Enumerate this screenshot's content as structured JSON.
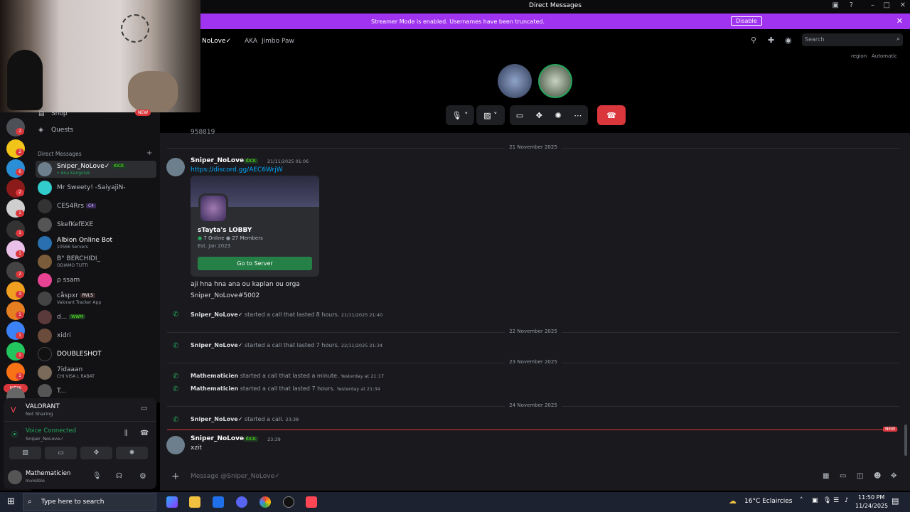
{
  "window": {
    "title": "Direct Messages"
  },
  "streamer": {
    "message": "Streamer Mode is enabled. Usernames have been truncated.",
    "disable_label": "Disable"
  },
  "call_header": {
    "name": "NoLove✓",
    "aka": "AKA",
    "aka_name": "Jimbo Paw",
    "search_placeholder": "Search",
    "region_label": "region",
    "region_value": "Automatic"
  },
  "sidebar": {
    "shop": "Shop",
    "quests": "Quests",
    "dm_header": "Direct Messages",
    "dms": [
      {
        "name": "Sniper_NoLove✓",
        "tag": "KICK",
        "sub": "• Ana Kangolak"
      },
      {
        "name": "Mr Sweety! -SaiyajiN-",
        "tag": "",
        "sub": ""
      },
      {
        "name": "CES4Rrs",
        "tag": "C4",
        "sub": ""
      },
      {
        "name": "SkefKefEXE",
        "tag": "",
        "sub": ""
      },
      {
        "name": "Albion Online Bot",
        "tag": "",
        "sub": "10566 Servers"
      },
      {
        "name": "B° BERCHIDI_",
        "tag": "",
        "sub": "ODIAMO TUTTI"
      },
      {
        "name": "ρ ssam",
        "tag": "",
        "sub": ""
      },
      {
        "name": "cåspxr",
        "tag": "RVLS",
        "sub": "Valorant Tracker App"
      },
      {
        "name": "d...",
        "tag": "WWM",
        "sub": ""
      },
      {
        "name": "xidri",
        "tag": "",
        "sub": ""
      },
      {
        "name": "DOUBLESHOT",
        "tag": "",
        "sub": ""
      },
      {
        "name": "7idaaan",
        "tag": "",
        "sub": "CHI VISA L RABAT"
      },
      {
        "name": "T...",
        "tag": "",
        "sub": ""
      }
    ],
    "new_badge": "NEW",
    "badges": [
      "2",
      "2",
      "6",
      "2",
      "1",
      "1",
      "1",
      "2",
      "3",
      "1",
      "1",
      "1",
      "1"
    ]
  },
  "activity": {
    "game": "VALORANT",
    "status": "Not Sharing"
  },
  "voice": {
    "status": "Voice Connected",
    "channel": "Sniper_NoLove✓"
  },
  "user": {
    "name": "Mathematicien",
    "status": "Invisible"
  },
  "chat": {
    "top_fragment": "958819",
    "dates": [
      "21 November 2025",
      "22 November 2025",
      "23 November 2025",
      "24 November 2025"
    ],
    "msg1": {
      "author": "Sniper_NoLove✓",
      "tag": "KICK",
      "time": "21/11/2025 01:06",
      "link": "https://discord.gg/AEC6WrjW"
    },
    "invite": {
      "server": "sTayta's LOBBY",
      "online": "7 Online",
      "members": "27 Members",
      "est": "Est. Jan 2023",
      "button": "Go to Server"
    },
    "line1": "aji hna hna ana ou kaplan ou orga",
    "line2": "Sniper_NoLove#5002",
    "calls": [
      {
        "author": "Sniper_NoLove✓",
        "text": "started a call that lasted 8 hours.",
        "time": "21/11/2025 21:40"
      },
      {
        "author": "Sniper_NoLove✓",
        "text": "started a call that lasted 7 hours.",
        "time": "22/11/2025 21:34"
      },
      {
        "author": "Mathematicien",
        "text": "started a call that lasted a minute.",
        "time": "Yesterday at 21:17"
      },
      {
        "author": "Mathematicien",
        "text": "started a call that lasted 7 hours.",
        "time": "Yesterday at 21:34"
      },
      {
        "author": "Sniper_NoLove✓",
        "text": "started a call.",
        "time": "23:38"
      }
    ],
    "new_label": "NEW",
    "msg2": {
      "author": "Sniper_NoLove✓",
      "tag": "KICK",
      "time": "23:39",
      "text": "xzit"
    },
    "composer_placeholder": "Message @Sniper_NoLove✓"
  },
  "taskbar": {
    "search": "Type here to search",
    "weather": "16°C  Eclaircies",
    "time": "11:50 PM",
    "date": "11/24/2025"
  },
  "colors": {
    "accent": "#5865f2",
    "streamer": "#a033f0",
    "green": "#23a55a",
    "danger": "#da373c"
  }
}
